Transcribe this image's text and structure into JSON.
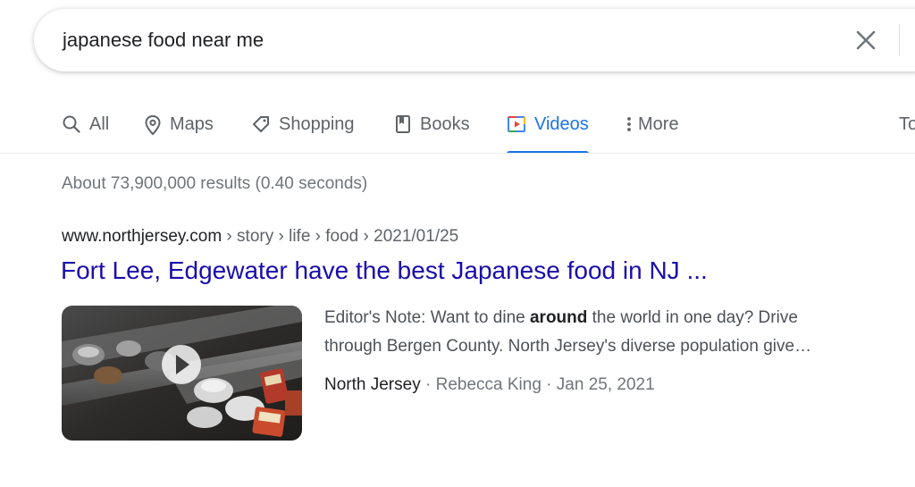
{
  "search": {
    "query": "japanese food near me"
  },
  "tabs": [
    {
      "label": "All",
      "icon": "search-icon",
      "active": false
    },
    {
      "label": "Maps",
      "icon": "map-pin-icon",
      "active": false
    },
    {
      "label": "Shopping",
      "icon": "tag-icon",
      "active": false
    },
    {
      "label": "Books",
      "icon": "book-icon",
      "active": false
    },
    {
      "label": "Videos",
      "icon": "video-play-icon",
      "active": true
    },
    {
      "label": "More",
      "icon": "more-vert-icon",
      "active": false
    },
    {
      "label": "To",
      "icon": "",
      "active": false
    }
  ],
  "stats": "About 73,900,000 results (0.40 seconds)",
  "result": {
    "breadcrumb_host": "www.northjersey.com",
    "breadcrumb_path": " › story › life › food › 2021/01/25",
    "title": "Fort Lee, Edgewater have the best Japanese food in NJ ...",
    "snippet_line1_pre": "Editor's Note: Want to dine ",
    "snippet_line1_bold": "around",
    "snippet_line1_post": " the world in one day? Drive",
    "snippet_line2": "through Bergen County. North Jersey's diverse population give…",
    "source": "North Jersey",
    "author": "Rebecca King",
    "date": "Jan 25, 2021",
    "separator": " · "
  },
  "colors": {
    "accent": "#1a73e8",
    "link": "#1a0dab",
    "muted": "#70757a"
  }
}
